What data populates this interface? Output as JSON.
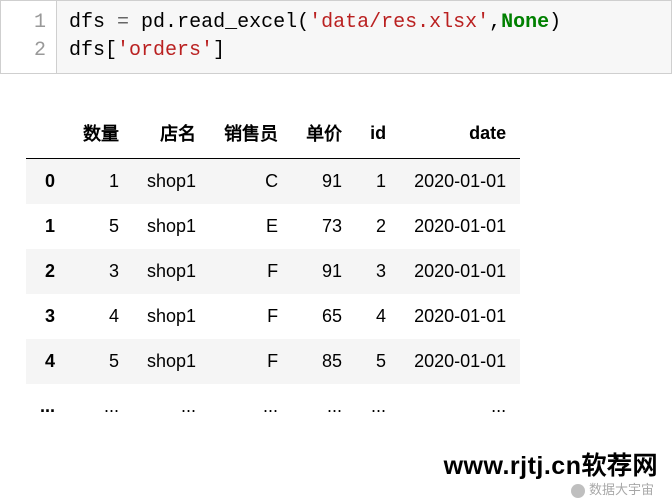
{
  "code": {
    "line_numbers": [
      "1",
      "2"
    ],
    "l1": {
      "var": "dfs",
      "eq": " = ",
      "obj": "pd",
      "dot": ".",
      "fn": "read_excel",
      "open": "(",
      "str": "'data/res.xlsx'",
      "comma": ",",
      "kw": "None",
      "close": ")"
    },
    "l2": {
      "var": "dfs",
      "open": "[",
      "str": "'orders'",
      "close": "]"
    }
  },
  "chart_data": {
    "type": "table",
    "columns": [
      "数量",
      "店名",
      "销售员",
      "单价",
      "id",
      "date"
    ],
    "index": [
      "0",
      "1",
      "2",
      "3",
      "4"
    ],
    "rows": [
      {
        "qty": "1",
        "shop": "shop1",
        "sales": "C",
        "price": "91",
        "id": "1",
        "date": "2020-01-01"
      },
      {
        "qty": "5",
        "shop": "shop1",
        "sales": "E",
        "price": "73",
        "id": "2",
        "date": "2020-01-01"
      },
      {
        "qty": "3",
        "shop": "shop1",
        "sales": "F",
        "price": "91",
        "id": "3",
        "date": "2020-01-01"
      },
      {
        "qty": "4",
        "shop": "shop1",
        "sales": "F",
        "price": "65",
        "id": "4",
        "date": "2020-01-01"
      },
      {
        "qty": "5",
        "shop": "shop1",
        "sales": "F",
        "price": "85",
        "id": "5",
        "date": "2020-01-01"
      }
    ],
    "ellipsis": "..."
  },
  "watermark": {
    "main": "www.rjtj.cn软荐网",
    "sub": "数据大宇宙"
  }
}
